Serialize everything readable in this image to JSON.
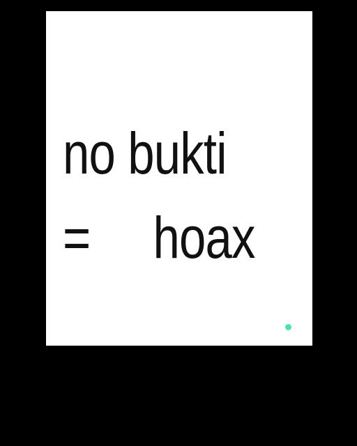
{
  "meme": {
    "line1": "no bukti",
    "equals": "=",
    "line2_word": "hoax"
  },
  "colors": {
    "background": "#000000",
    "card": "#ffffff",
    "text": "#111111",
    "indicator_dot": "#4fe3a8"
  }
}
